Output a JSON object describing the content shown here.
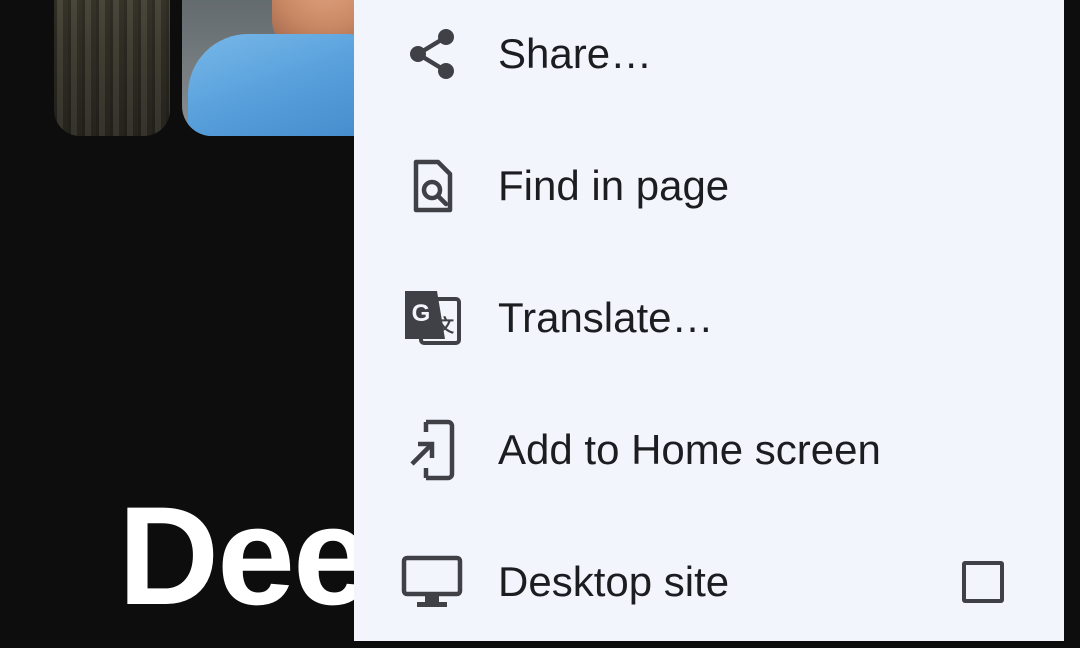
{
  "background": {
    "page_title_fragment": "Dee"
  },
  "menu": {
    "items": [
      {
        "label": "Share…",
        "icon": "share-icon"
      },
      {
        "label": "Find in page",
        "icon": "find-in-page-icon"
      },
      {
        "label": "Translate…",
        "icon": "translate-icon"
      },
      {
        "label": "Add to Home screen",
        "icon": "add-to-home-screen-icon"
      },
      {
        "label": "Desktop site",
        "icon": "desktop-icon",
        "checked": false
      }
    ]
  },
  "colors": {
    "menu_background": "#f2f5fc",
    "text": "#1c1d21",
    "icon": "#3f4147"
  }
}
